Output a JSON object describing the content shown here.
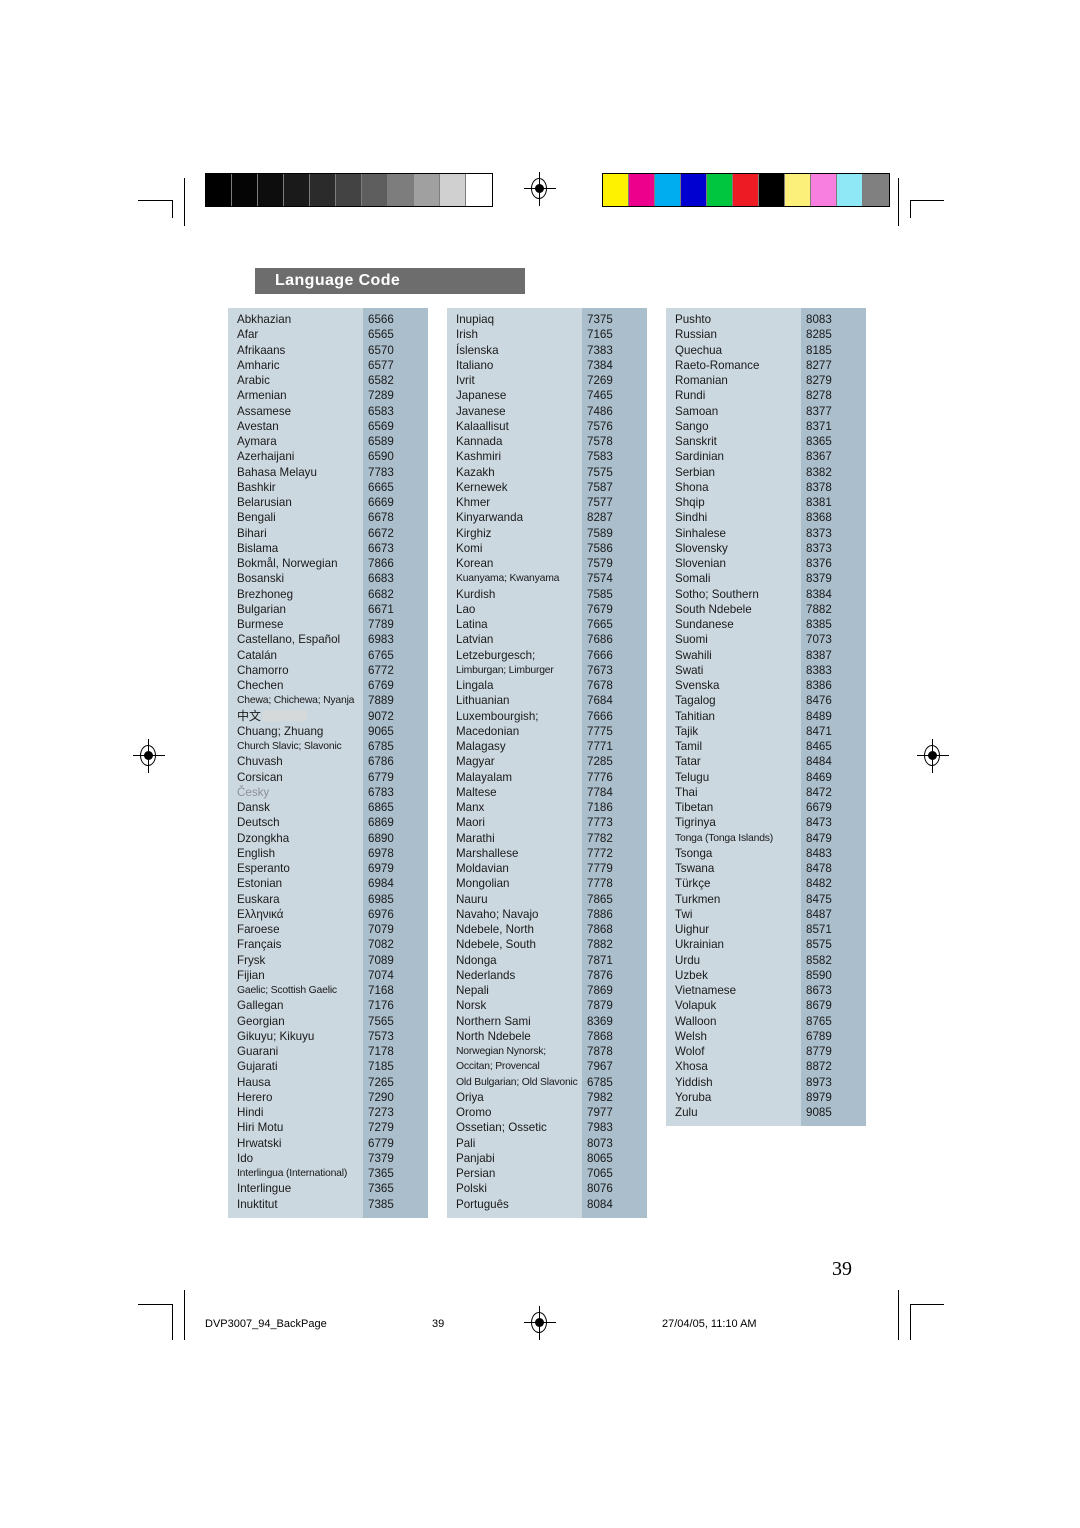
{
  "header": {
    "title": "Language Code"
  },
  "calibration": {
    "grayscale_label": "grayscale-strip",
    "grayscale_patches": [
      "#000000",
      "#050505",
      "#0d0d0d",
      "#1a1a1a",
      "#2b2b2b",
      "#434343",
      "#5e5e5e",
      "#7d7d7d",
      "#a0a0a0",
      "#d0d0d0",
      "#ffffff"
    ],
    "color_label": "color-strip",
    "color_patches": [
      "#fff200",
      "#ec008c",
      "#00aeef",
      "#0000d0",
      "#00c63f",
      "#ed1c24",
      "#000000",
      "#fdf07a",
      "#f87fe0",
      "#8fe8f5",
      "#808080"
    ]
  },
  "footer": {
    "file_name": "DVP3007_94_BackPage",
    "page_marker": "39",
    "timestamp": "27/04/05, 11:10 AM",
    "page_number": "39"
  },
  "table": {
    "columns": [
      {
        "id": "column-1",
        "rows": [
          {
            "name": "Abkhazian",
            "code": "6566"
          },
          {
            "name": "Afar",
            "code": "6565"
          },
          {
            "name": "Afrikaans",
            "code": "6570"
          },
          {
            "name": "Amharic",
            "code": "6577"
          },
          {
            "name": "Arabic",
            "code": "6582"
          },
          {
            "name": "Armenian",
            "code": "7289"
          },
          {
            "name": "Assamese",
            "code": "6583"
          },
          {
            "name": "Avestan",
            "code": "6569"
          },
          {
            "name": "Aymara",
            "code": "6589"
          },
          {
            "name": "Azerhaijani",
            "code": "6590"
          },
          {
            "name": "Bahasa Melayu",
            "code": "7783"
          },
          {
            "name": "Bashkir",
            "code": "6665"
          },
          {
            "name": "Belarusian",
            "code": "6669"
          },
          {
            "name": "Bengali",
            "code": "6678"
          },
          {
            "name": "Bihari",
            "code": "6672"
          },
          {
            "name": "Bislama",
            "code": "6673"
          },
          {
            "name": "Bokmål, Norwegian",
            "code": "7866"
          },
          {
            "name": "Bosanski",
            "code": "6683"
          },
          {
            "name": "Brezhoneg",
            "code": "6682"
          },
          {
            "name": "Bulgarian",
            "code": "6671"
          },
          {
            "name": "Burmese",
            "code": "7789"
          },
          {
            "name": "Castellano, Español",
            "code": "6983"
          },
          {
            "name": "Catalán",
            "code": "6765"
          },
          {
            "name": "Chamorro",
            "code": "6772"
          },
          {
            "name": "Chechen",
            "code": "6769"
          },
          {
            "name": "Chewa; Chichewa; Nyanja",
            "code": "7889",
            "style": "tight"
          },
          {
            "name": "中文",
            "code": "9072",
            "style": "cjk",
            "redacted": true
          },
          {
            "name": "Chuang; Zhuang",
            "code": "9065"
          },
          {
            "name": "Church Slavic; Slavonic",
            "code": "6785",
            "style": "tight"
          },
          {
            "name": "Chuvash",
            "code": "6786"
          },
          {
            "name": "Corsican",
            "code": "6779"
          },
          {
            "name": "Česky",
            "code": "6783",
            "style": "faint"
          },
          {
            "name": "Dansk",
            "code": "6865"
          },
          {
            "name": "Deutsch",
            "code": "6869"
          },
          {
            "name": "Dzongkha",
            "code": "6890"
          },
          {
            "name": "English",
            "code": "6978"
          },
          {
            "name": "Esperanto",
            "code": "6979"
          },
          {
            "name": "Estonian",
            "code": "6984"
          },
          {
            "name": "Euskara",
            "code": "6985"
          },
          {
            "name": "Ελληνικά",
            "code": "6976"
          },
          {
            "name": "Faroese",
            "code": "7079"
          },
          {
            "name": "Français",
            "code": "7082"
          },
          {
            "name": "Frysk",
            "code": "7089"
          },
          {
            "name": "Fijian",
            "code": "7074"
          },
          {
            "name": "Gaelic; Scottish Gaelic",
            "code": "7168",
            "style": "tight"
          },
          {
            "name": "Gallegan",
            "code": "7176"
          },
          {
            "name": "Georgian",
            "code": "7565"
          },
          {
            "name": "Gikuyu; Kikuyu",
            "code": "7573"
          },
          {
            "name": "Guarani",
            "code": "7178"
          },
          {
            "name": "Gujarati",
            "code": "7185"
          },
          {
            "name": "Hausa",
            "code": "7265"
          },
          {
            "name": "Herero",
            "code": "7290"
          },
          {
            "name": "Hindi",
            "code": "7273"
          },
          {
            "name": "Hiri Motu",
            "code": "7279"
          },
          {
            "name": "Hrwatski",
            "code": "6779"
          },
          {
            "name": "Ido",
            "code": "7379"
          },
          {
            "name": "Interlingua (International)",
            "code": "7365",
            "style": "tight"
          },
          {
            "name": "Interlingue",
            "code": "7365"
          },
          {
            "name": "Inuktitut",
            "code": "7385"
          }
        ]
      },
      {
        "id": "column-2",
        "rows": [
          {
            "name": "Inupiaq",
            "code": "7375"
          },
          {
            "name": "Irish",
            "code": "7165"
          },
          {
            "name": "Íslenska",
            "code": "7383"
          },
          {
            "name": "Italiano",
            "code": "7384"
          },
          {
            "name": "Ivrit",
            "code": "7269"
          },
          {
            "name": "Japanese",
            "code": "7465"
          },
          {
            "name": "Javanese",
            "code": "7486"
          },
          {
            "name": "Kalaallisut",
            "code": "7576"
          },
          {
            "name": "Kannada",
            "code": "7578"
          },
          {
            "name": "Kashmiri",
            "code": "7583"
          },
          {
            "name": "Kazakh",
            "code": "7575"
          },
          {
            "name": "Kernewek",
            "code": "7587"
          },
          {
            "name": "Khmer",
            "code": "7577"
          },
          {
            "name": "Kinyarwanda",
            "code": "8287"
          },
          {
            "name": "Kirghiz",
            "code": "7589"
          },
          {
            "name": "Komi",
            "code": "7586"
          },
          {
            "name": "Korean",
            "code": "7579"
          },
          {
            "name": "Kuanyama; Kwanyama",
            "code": "7574",
            "style": "tight"
          },
          {
            "name": "Kurdish",
            "code": "7585"
          },
          {
            "name": "Lao",
            "code": "7679"
          },
          {
            "name": "Latina",
            "code": "7665"
          },
          {
            "name": "Latvian",
            "code": "7686"
          },
          {
            "name": "Letzeburgesch;",
            "code": "7666"
          },
          {
            "name": "Limburgan; Limburger",
            "code": "7673",
            "style": "tight"
          },
          {
            "name": "Lingala",
            "code": "7678"
          },
          {
            "name": "Lithuanian",
            "code": "7684"
          },
          {
            "name": "Luxembourgish;",
            "code": "7666"
          },
          {
            "name": "Macedonian",
            "code": "7775"
          },
          {
            "name": "Malagasy",
            "code": "7771"
          },
          {
            "name": "Magyar",
            "code": "7285"
          },
          {
            "name": "Malayalam",
            "code": "7776"
          },
          {
            "name": "Maltese",
            "code": "7784"
          },
          {
            "name": "Manx",
            "code": "7186"
          },
          {
            "name": "Maori",
            "code": "7773"
          },
          {
            "name": "Marathi",
            "code": "7782"
          },
          {
            "name": "Marshallese",
            "code": "7772"
          },
          {
            "name": "Moldavian",
            "code": "7779"
          },
          {
            "name": "Mongolian",
            "code": "7778"
          },
          {
            "name": "Nauru",
            "code": "7865"
          },
          {
            "name": "Navaho; Navajo",
            "code": "7886"
          },
          {
            "name": "Ndebele, North",
            "code": "7868"
          },
          {
            "name": "Ndebele, South",
            "code": "7882"
          },
          {
            "name": "Ndonga",
            "code": "7871"
          },
          {
            "name": "Nederlands",
            "code": "7876"
          },
          {
            "name": "Nepali",
            "code": "7869"
          },
          {
            "name": "Norsk",
            "code": "7879"
          },
          {
            "name": "Northern Sami",
            "code": "8369"
          },
          {
            "name": "North Ndebele",
            "code": "7868"
          },
          {
            "name": "Norwegian Nynorsk;",
            "code": "7878",
            "style": "tight"
          },
          {
            "name": "Occitan; Provencal",
            "code": "7967",
            "style": "tight"
          },
          {
            "name": "Old Bulgarian; Old Slavonic",
            "code": "6785",
            "style": "tight"
          },
          {
            "name": "Oriya",
            "code": "7982"
          },
          {
            "name": "Oromo",
            "code": "7977"
          },
          {
            "name": "Ossetian; Ossetic",
            "code": "7983"
          },
          {
            "name": "Pali",
            "code": "8073"
          },
          {
            "name": "Panjabi",
            "code": "8065"
          },
          {
            "name": "Persian",
            "code": "7065"
          },
          {
            "name": "Polski",
            "code": "8076"
          },
          {
            "name": "Português",
            "code": "8084"
          }
        ]
      },
      {
        "id": "column-3",
        "rows": [
          {
            "name": "Pushto",
            "code": "8083"
          },
          {
            "name": "Russian",
            "code": "8285"
          },
          {
            "name": "Quechua",
            "code": "8185"
          },
          {
            "name": "Raeto-Romance",
            "code": "8277"
          },
          {
            "name": "Romanian",
            "code": "8279"
          },
          {
            "name": "Rundi",
            "code": "8278"
          },
          {
            "name": "Samoan",
            "code": "8377"
          },
          {
            "name": "Sango",
            "code": "8371"
          },
          {
            "name": "Sanskrit",
            "code": "8365"
          },
          {
            "name": "Sardinian",
            "code": "8367"
          },
          {
            "name": "Serbian",
            "code": "8382"
          },
          {
            "name": "Shona",
            "code": "8378"
          },
          {
            "name": "Shqip",
            "code": "8381"
          },
          {
            "name": "Sindhi",
            "code": "8368"
          },
          {
            "name": "Sinhalese",
            "code": "8373"
          },
          {
            "name": "Slovensky",
            "code": "8373"
          },
          {
            "name": "Slovenian",
            "code": "8376"
          },
          {
            "name": "Somali",
            "code": "8379"
          },
          {
            "name": "Sotho; Southern",
            "code": "8384"
          },
          {
            "name": "South Ndebele",
            "code": "7882"
          },
          {
            "name": "Sundanese",
            "code": "8385"
          },
          {
            "name": "Suomi",
            "code": "7073"
          },
          {
            "name": "Swahili",
            "code": "8387"
          },
          {
            "name": "Swati",
            "code": "8383"
          },
          {
            "name": "Svenska",
            "code": "8386"
          },
          {
            "name": "Tagalog",
            "code": "8476"
          },
          {
            "name": "Tahitian",
            "code": "8489"
          },
          {
            "name": "Tajik",
            "code": "8471"
          },
          {
            "name": "Tamil",
            "code": "8465"
          },
          {
            "name": "Tatar",
            "code": "8484"
          },
          {
            "name": "Telugu",
            "code": "8469"
          },
          {
            "name": "Thai",
            "code": "8472"
          },
          {
            "name": "Tibetan",
            "code": "6679"
          },
          {
            "name": "Tigrinya",
            "code": "8473"
          },
          {
            "name": "Tonga (Tonga Islands)",
            "code": "8479",
            "style": "tight"
          },
          {
            "name": "Tsonga",
            "code": "8483"
          },
          {
            "name": "Tswana",
            "code": "8478"
          },
          {
            "name": "Türkçe",
            "code": "8482"
          },
          {
            "name": "Turkmen",
            "code": "8475"
          },
          {
            "name": "Twi",
            "code": "8487"
          },
          {
            "name": "Uighur",
            "code": "8571"
          },
          {
            "name": "Ukrainian",
            "code": "8575"
          },
          {
            "name": "Urdu",
            "code": "8582"
          },
          {
            "name": "Uzbek",
            "code": "8590"
          },
          {
            "name": "Vietnamese",
            "code": "8673"
          },
          {
            "name": "Volapuk",
            "code": "8679"
          },
          {
            "name": "Walloon",
            "code": "8765"
          },
          {
            "name": "Welsh",
            "code": "6789"
          },
          {
            "name": "Wolof",
            "code": "8779"
          },
          {
            "name": "Xhosa",
            "code": "8872"
          },
          {
            "name": "Yiddish",
            "code": "8973"
          },
          {
            "name": "Yoruba",
            "code": "8979"
          },
          {
            "name": "Zulu",
            "code": "9085"
          }
        ]
      }
    ]
  }
}
